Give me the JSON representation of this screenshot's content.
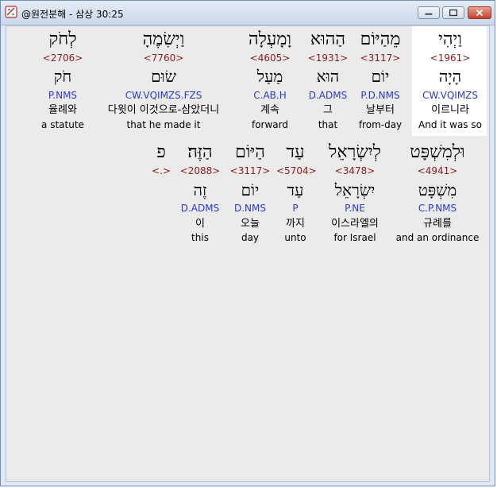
{
  "window": {
    "title": "@원전분해 - 삼상 30:25"
  },
  "row1": [
    {
      "heb": "וַיְהִי",
      "strong": "<1961>",
      "lemma": "הָיָה",
      "morph": "CW.VQIMZS",
      "kor": "이르니라",
      "eng": "And it was so"
    },
    {
      "heb": "מֵהַיּוֹם",
      "strong": "<3117>",
      "lemma": "יוֹם",
      "morph": "P.D.NMS",
      "kor": "날부터",
      "eng": "from-day"
    },
    {
      "heb": "הַהוּא",
      "strong": "<1931>",
      "lemma": "הוּא",
      "morph": "D.ADMS",
      "kor": "그",
      "eng": "that"
    },
    {
      "heb": "וָמָעְלָה",
      "strong": "<4605>",
      "lemma": "מַעַל",
      "morph": "C.AB.H",
      "kor": "계속",
      "eng": "forward"
    },
    {
      "heb": "וַיְשִׂמֶהָ",
      "strong": "<7760>",
      "lemma": "שׂוּם",
      "morph": "CW.VQIMZS.FZS",
      "kor": "다윗이 이것으로-삼았더니",
      "eng": "that he made it"
    },
    {
      "heb": "לְחֹק",
      "strong": "<2706>",
      "lemma": "חֹק",
      "morph": "P.NMS",
      "kor": "율례와",
      "eng": "a statute"
    }
  ],
  "row2": [
    {
      "heb": "וּלְמִשְׁפָּט",
      "strong": "<4941>",
      "lemma": "מִשְׁפָּט",
      "morph": "C.P.NMS",
      "kor": "규례를",
      "eng": "and an ordinance"
    },
    {
      "heb": "לְיִשְׂרָאֵל",
      "strong": "<3478>",
      "lemma": "יִשְׂרָאֵל",
      "morph": "P.NE",
      "kor": "이스라엘의",
      "eng": "for Israel"
    },
    {
      "heb": "עַד",
      "strong": "<5704>",
      "lemma": "עַד",
      "morph": "P",
      "kor": "까지",
      "eng": "unto"
    },
    {
      "heb": "הַיּוֹם",
      "strong": "<3117>",
      "lemma": "יוֹם",
      "morph": "D.NMS",
      "kor": "오늘",
      "eng": "day"
    },
    {
      "heb": "הַזֶּה׃",
      "strong": "<2088>",
      "lemma": "זֶה",
      "morph": "D.ADMS",
      "kor": "이",
      "eng": "this"
    },
    {
      "heb": "פ",
      "strong": "<.>",
      "lemma": "",
      "morph": "",
      "kor": "",
      "eng": ""
    }
  ]
}
